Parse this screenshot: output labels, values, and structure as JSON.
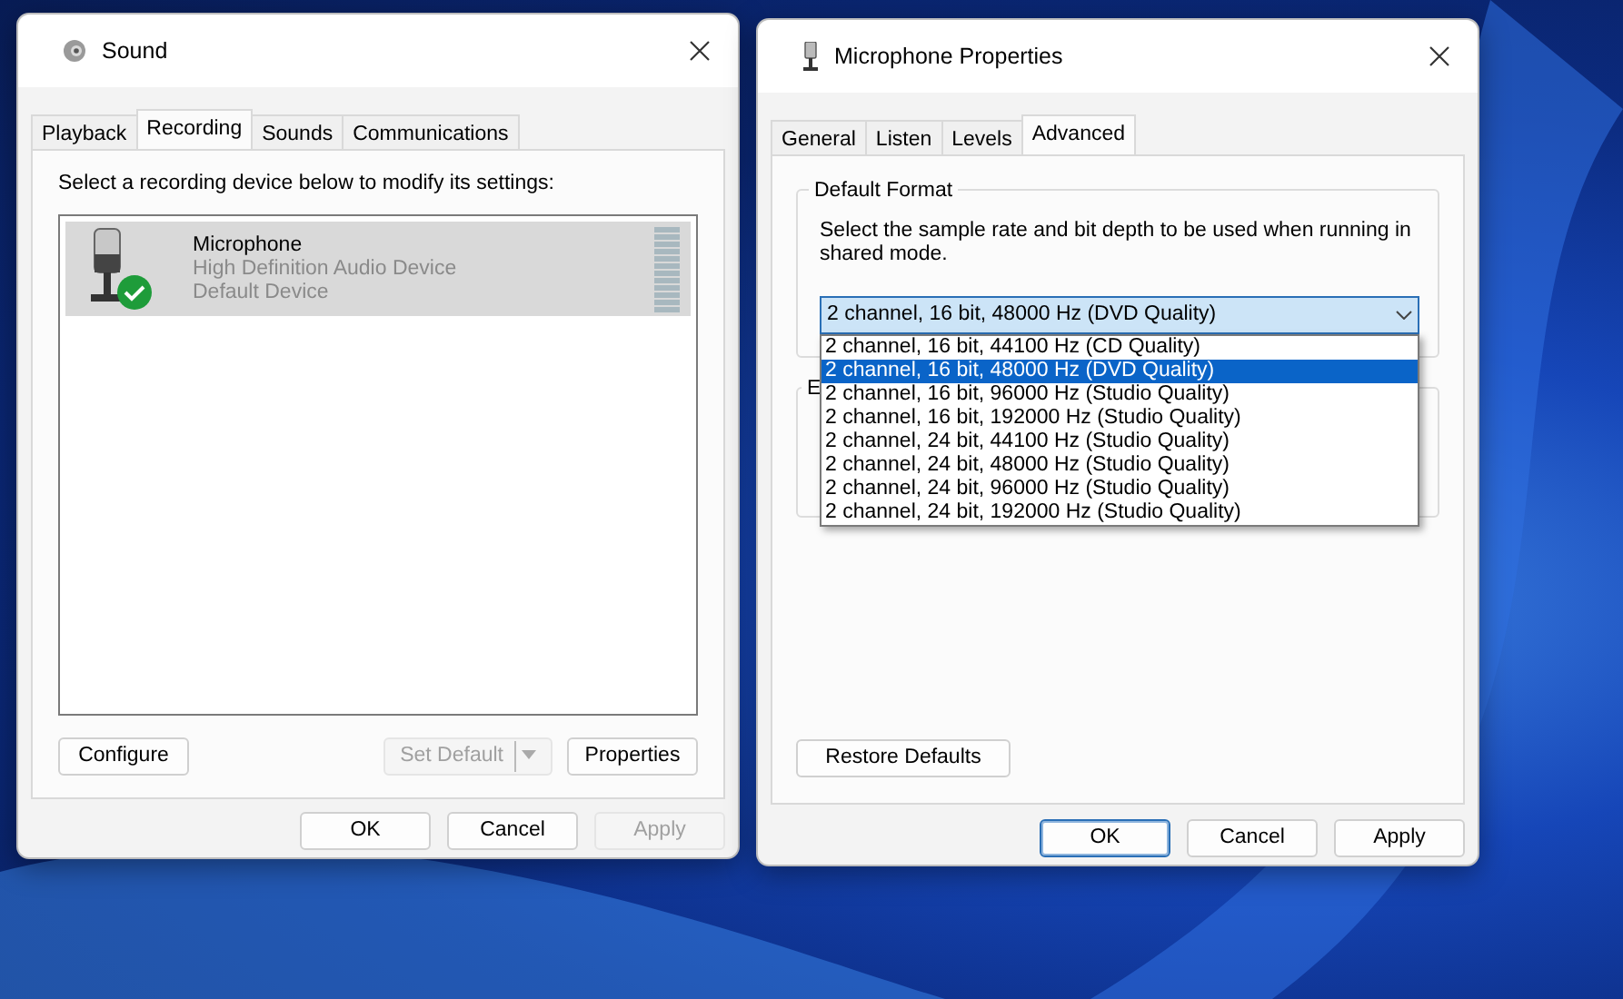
{
  "sound_window": {
    "title": "Sound",
    "tabs": [
      {
        "label": "Playback",
        "selected": false
      },
      {
        "label": "Recording",
        "selected": true
      },
      {
        "label": "Sounds",
        "selected": false
      },
      {
        "label": "Communications",
        "selected": false
      }
    ],
    "instruction": "Select a recording device below to modify its settings:",
    "devices": [
      {
        "name": "Microphone",
        "driver": "High Definition Audio Device",
        "status": "Default Device",
        "selected": true,
        "is_default": true
      }
    ],
    "buttons": [
      {
        "label": "Configure",
        "kind": "plain",
        "disabled": false
      },
      {
        "label": "Set Default",
        "kind": "split",
        "disabled": true
      },
      {
        "label": "Properties",
        "kind": "plain",
        "disabled": false
      }
    ],
    "dialog_buttons": [
      {
        "label": "OK",
        "disabled": false,
        "focused": false
      },
      {
        "label": "Cancel",
        "disabled": false,
        "focused": false
      },
      {
        "label": "Apply",
        "disabled": true,
        "focused": false
      }
    ]
  },
  "properties_window": {
    "title": "Microphone Properties",
    "tabs": [
      {
        "label": "General",
        "selected": false
      },
      {
        "label": "Listen",
        "selected": false
      },
      {
        "label": "Levels",
        "selected": false
      },
      {
        "label": "Advanced",
        "selected": true
      }
    ],
    "default_format": {
      "title": "Default Format",
      "description": "Select the sample rate and bit depth to be used when running in shared mode.",
      "combo": {
        "value": "2 channel, 16 bit, 48000 Hz (DVD Quality)",
        "expanded": true
      },
      "options": [
        {
          "label": "2 channel, 16 bit, 44100 Hz (CD Quality)",
          "selected": false
        },
        {
          "label": "2 channel, 16 bit, 48000 Hz (DVD Quality)",
          "selected": true
        },
        {
          "label": "2 channel, 16 bit, 96000 Hz (Studio Quality)",
          "selected": false
        },
        {
          "label": "2 channel, 16 bit, 192000 Hz (Studio Quality)",
          "selected": false
        },
        {
          "label": "2 channel, 24 bit, 44100 Hz (Studio Quality)",
          "selected": false
        },
        {
          "label": "2 channel, 24 bit, 48000 Hz (Studio Quality)",
          "selected": false
        },
        {
          "label": "2 channel, 24 bit, 96000 Hz (Studio Quality)",
          "selected": false
        },
        {
          "label": "2 channel, 24 bit, 192000 Hz (Studio Quality)",
          "selected": false
        }
      ]
    },
    "group_2": {
      "title": "E"
    },
    "restore_button": {
      "label": "Restore Defaults",
      "disabled": false
    },
    "dialog_buttons": [
      {
        "label": "OK",
        "disabled": false,
        "focused": true
      },
      {
        "label": "Cancel",
        "disabled": false,
        "focused": false
      },
      {
        "label": "Apply",
        "disabled": false,
        "focused": false
      }
    ]
  }
}
